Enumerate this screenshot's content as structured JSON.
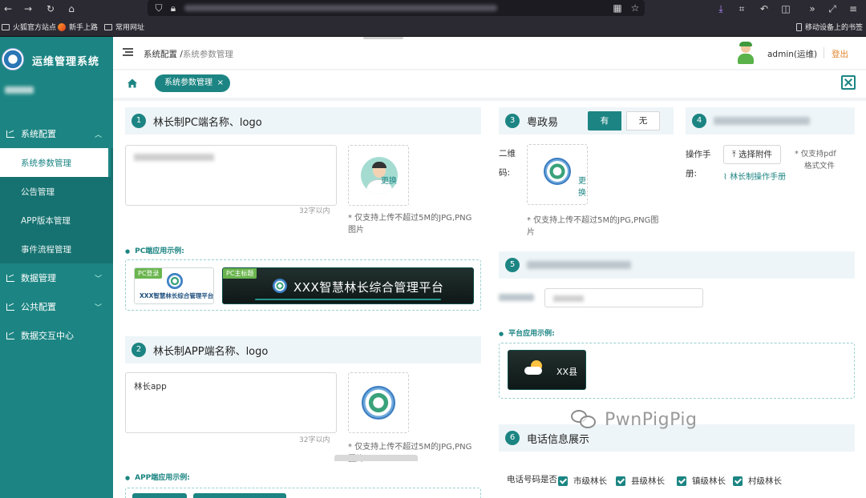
{
  "browser": {
    "bookmarks": [
      "火狐官方站点",
      "新手上路",
      "常用网址"
    ],
    "mobile_bookmarks": "移动设备上的书签"
  },
  "sidebar": {
    "app_title": "运维管理系统",
    "groups": [
      {
        "label": "系统配置",
        "expanded": true,
        "items": [
          "系统参数管理",
          "公告管理",
          "APP版本管理",
          "事件流程管理"
        ]
      },
      {
        "label": "数据管理"
      },
      {
        "label": "公共配置"
      },
      {
        "label": "数据交互中心"
      }
    ]
  },
  "header": {
    "breadcrumb_root": "系统配置",
    "breadcrumb_sep": "/",
    "breadcrumb_current": "系统参数管理",
    "username": "admin(运维)",
    "logout": "登出"
  },
  "tags": {
    "active": "系统参数管理",
    "close": "×"
  },
  "sections": {
    "s1": {
      "num": "1",
      "title": "林长制PC端名称、logo",
      "count_hint": "32字以内",
      "change": "更换",
      "upload_hint_1": "* 仅支持上传不超过5M的JPG,PNG",
      "upload_hint_2": "图片",
      "example_label": "PC端应用示例:",
      "example_login_badge": "PC登录",
      "example_login_text": "XXX智慧林长综合管理平台",
      "example_title_badge": "PC主标题",
      "example_title_text": "XXX智慧林长综合管理平台"
    },
    "s2": {
      "num": "2",
      "title": "林长制APP端名称、logo",
      "value": "林长app",
      "count_hint": "32字以内",
      "upload_hint_1": "* 仅支持上传不超过5M的JPG,PNG",
      "upload_hint_2": "图片",
      "example_label": "APP端应用示例:"
    },
    "s3": {
      "num": "3",
      "title": "粤政易",
      "opt_yes": "有",
      "opt_no": "无",
      "qr_label": "二维",
      "qr_label_2": "码:",
      "change": "更换",
      "upload_hint_1": "* 仅支持上传不超过5M的JPG,PNG图",
      "upload_hint_2": "片"
    },
    "s4": {
      "num": "4",
      "manual_label": "操作手",
      "manual_label_2": "册:",
      "upload_btn": "选择附件",
      "pdf_hint_1": "* 仅支持pdf",
      "pdf_hint_2": "格式文件",
      "file_name": "林长制操作手册"
    },
    "s5": {
      "num": "5",
      "example_label": "平台应用示例:",
      "example_text": "XX县"
    },
    "s6": {
      "num": "6",
      "title": "电话信息展示",
      "phone_label": "电话号码是否",
      "options": [
        "市级林长",
        "县级林长",
        "镇级林长",
        "村级林长"
      ]
    }
  },
  "watermark": "PwnPigPig",
  "colors": {
    "primary": "#1c8583",
    "logout": "#e3862d",
    "section_bg": "#eef5f8"
  }
}
